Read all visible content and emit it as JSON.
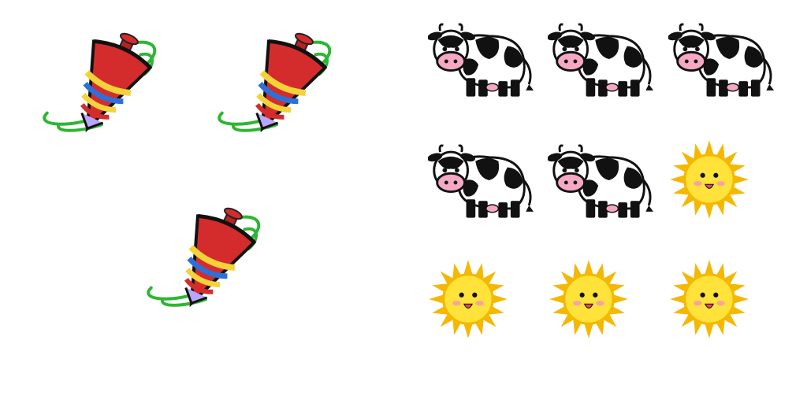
{
  "scene": {
    "left_group": {
      "object": "spinning-top",
      "count": 3
    },
    "right_group": [
      {
        "object": "cow",
        "count": 5
      },
      {
        "object": "sun",
        "count": 4
      }
    ]
  },
  "colors": {
    "background": "#ffffff",
    "top_red": "#d42c2c",
    "top_yellow": "#f4d23a",
    "top_blue": "#2f6fd8",
    "motion_lines": "#2fb534",
    "cow_black": "#111111",
    "cow_pink": "#f4a8c4",
    "sun_yellow": "#ffe23a",
    "sun_orange": "#f5b800"
  }
}
